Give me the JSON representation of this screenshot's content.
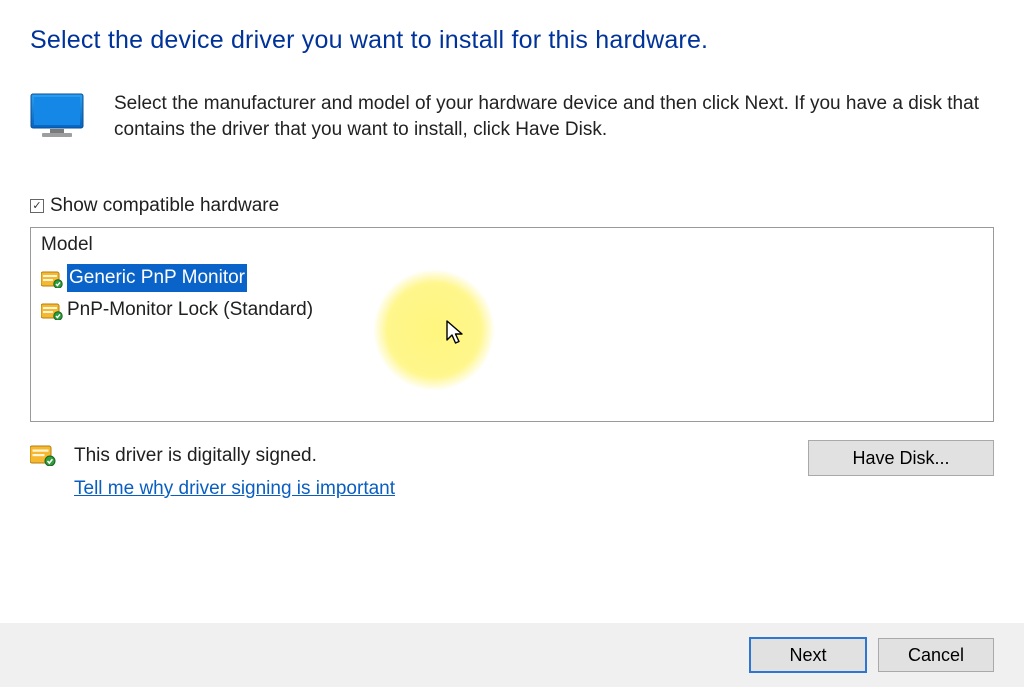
{
  "title": "Select the device driver you want to install for this hardware.",
  "intro": "Select the manufacturer and model of your hardware device and then click Next. If you have a disk that contains the driver that you want to install, click Have Disk.",
  "checkbox": {
    "label": "Show compatible hardware",
    "checked": true
  },
  "list": {
    "header": "Model",
    "items": [
      {
        "label": "Generic PnP Monitor",
        "selected": true
      },
      {
        "label": "PnP-Monitor Lock (Standard)",
        "selected": false
      }
    ]
  },
  "signed": {
    "status": "This driver is digitally signed.",
    "link": "Tell me why driver signing is important"
  },
  "buttons": {
    "have_disk": "Have Disk...",
    "next": "Next",
    "cancel": "Cancel"
  }
}
